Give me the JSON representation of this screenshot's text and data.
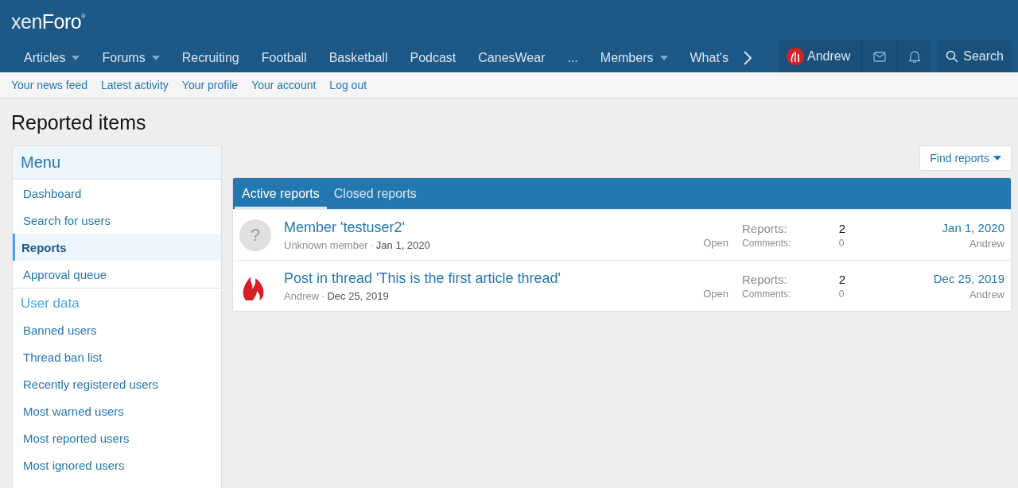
{
  "logo": {
    "light": "xen",
    "bold": "Foro",
    "mark": "®"
  },
  "nav": [
    {
      "label": "Articles",
      "dropdown": true,
      "selected": false
    },
    {
      "label": "Forums",
      "dropdown": true,
      "selected": false
    },
    {
      "label": "Recruiting",
      "dropdown": false,
      "selected": false
    },
    {
      "label": "Football",
      "dropdown": false,
      "selected": false
    },
    {
      "label": "Basketball",
      "dropdown": false,
      "selected": false
    },
    {
      "label": "Podcast",
      "dropdown": false,
      "selected": false
    },
    {
      "label": "CanesWear",
      "dropdown": false,
      "selected": false
    },
    {
      "label": "...",
      "dropdown": false,
      "selected": false
    },
    {
      "label": "Members",
      "dropdown": true,
      "selected": false
    },
    {
      "label": "What's",
      "dropdown": false,
      "selected": false
    }
  ],
  "user": {
    "name": "Andrew"
  },
  "search": {
    "label": "Search"
  },
  "subnav": [
    "Your news feed",
    "Latest activity",
    "Your profile",
    "Your account",
    "Log out"
  ],
  "page_title": "Reported items",
  "sidebar": [
    {
      "kind": "heading",
      "label": "Menu"
    },
    {
      "kind": "link",
      "label": "Dashboard",
      "selected": false
    },
    {
      "kind": "link",
      "label": "Search for users",
      "selected": false
    },
    {
      "kind": "link",
      "label": "Reports",
      "selected": true
    },
    {
      "kind": "link",
      "label": "Approval queue",
      "selected": false
    },
    {
      "kind": "section",
      "label": "User data"
    },
    {
      "kind": "link",
      "label": "Banned users",
      "selected": false
    },
    {
      "kind": "link",
      "label": "Thread ban list",
      "selected": false
    },
    {
      "kind": "link",
      "label": "Recently registered users",
      "selected": false
    },
    {
      "kind": "link",
      "label": "Most warned users",
      "selected": false
    },
    {
      "kind": "link",
      "label": "Most reported users",
      "selected": false
    },
    {
      "kind": "link",
      "label": "Most ignored users",
      "selected": false
    }
  ],
  "find_button": "Find reports",
  "tabs": [
    {
      "label": "Active reports",
      "selected": true
    },
    {
      "label": "Closed reports",
      "selected": false
    }
  ],
  "reports": [
    {
      "kind": "unknown",
      "avatar_glyph": "?",
      "title": "Member 'testuser2'",
      "author": "Unknown member",
      "separator": "·",
      "date": "Jan 1, 2020",
      "status": "Open",
      "reports_label": "Reports:",
      "reports": "2",
      "comments_label": "Comments:",
      "comments": "0",
      "last_date": "Jan 1, 2020",
      "last_user": "Andrew"
    },
    {
      "kind": "flame",
      "title": "Post in thread 'This is the first article thread'",
      "author": "Andrew",
      "separator": "·",
      "date": "Dec 25, 2019",
      "status": "Open",
      "reports_label": "Reports:",
      "reports": "2",
      "comments_label": "Comments:",
      "comments": "0",
      "last_date": "Dec 25, 2019",
      "last_user": "Andrew"
    }
  ]
}
